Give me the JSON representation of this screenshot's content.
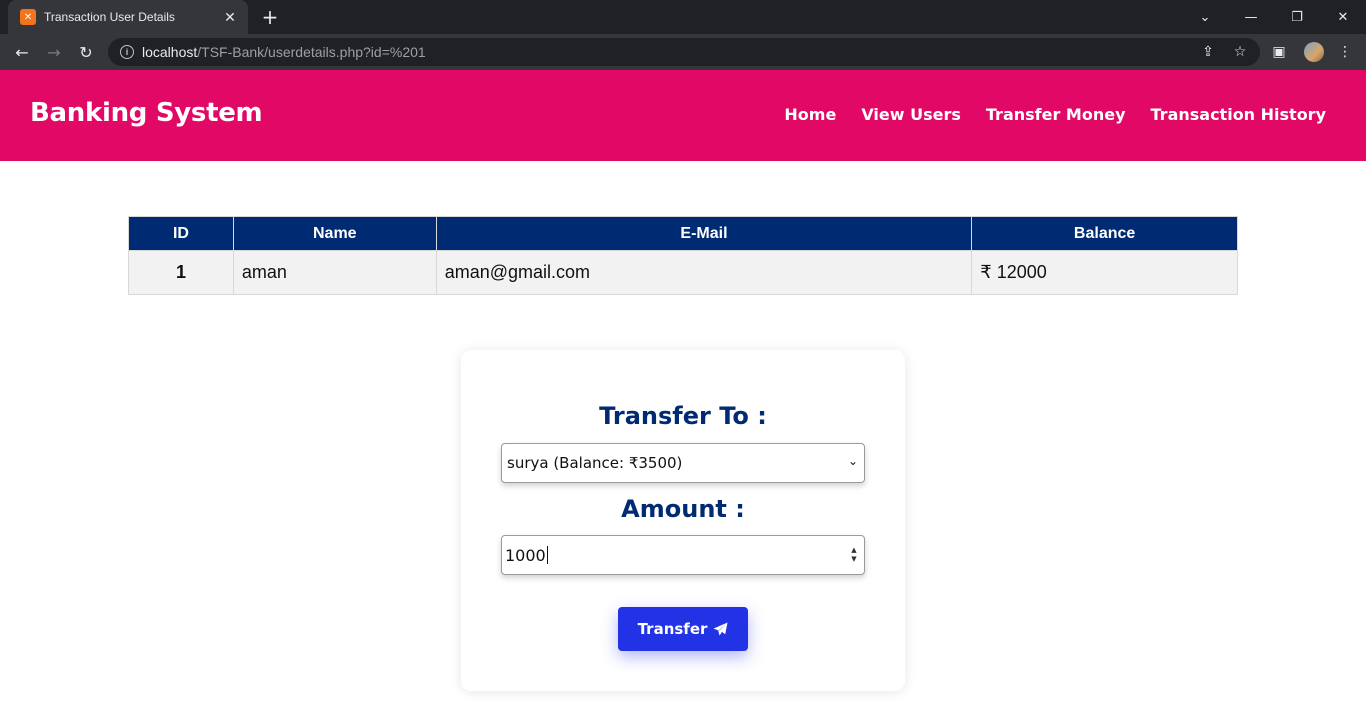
{
  "browser": {
    "tab_title": "Transaction User Details",
    "tab_favicon": "xampp-icon",
    "url_host": "localhost",
    "url_path": "/TSF-Bank/userdetails.php?id=%201"
  },
  "navbar": {
    "brand": "Banking System",
    "links": [
      "Home",
      "View Users",
      "Transfer Money",
      "Transaction History"
    ],
    "bg_color": "#e10866"
  },
  "table": {
    "headers": [
      "ID",
      "Name",
      "E-Mail",
      "Balance"
    ],
    "row": {
      "id": "1",
      "name": "aman",
      "email": "aman@gmail.com",
      "balance": "₹ 12000"
    },
    "header_color": "#002b72"
  },
  "form": {
    "transfer_to_label": "Transfer To :",
    "selected_recipient": "surya (Balance: ₹3500)",
    "amount_label": "Amount :",
    "amount_value": "1000",
    "submit_label": "Transfer",
    "submit_icon": "paper-plane-icon",
    "button_color": "#2233e6"
  }
}
